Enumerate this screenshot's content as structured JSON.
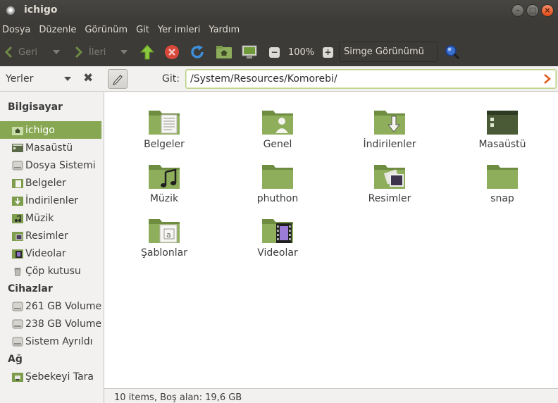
{
  "window": {
    "title": "ichigo"
  },
  "menu": [
    "Dosya",
    "Düzenle",
    "Görünüm",
    "Git",
    "Yer imleri",
    "Yardım"
  ],
  "toolbar": {
    "back_label": "Geri",
    "forward_label": "İleri",
    "zoom_level": "100%",
    "view_mode": "Simge Görünümü"
  },
  "location": {
    "places_label": "Yerler",
    "go_label": "Git:",
    "path": "/System/Resources/Komorebi/"
  },
  "sidebar": {
    "computer_heading": "Bilgisayar",
    "computer_items": [
      {
        "label": "ichigo",
        "icon": "home-folder-icon",
        "selected": true
      },
      {
        "label": "Masaüstü",
        "icon": "desktop-icon"
      },
      {
        "label": "Dosya Sistemi",
        "icon": "drive-icon"
      },
      {
        "label": "Belgeler",
        "icon": "documents-folder-icon"
      },
      {
        "label": "İndirilenler",
        "icon": "downloads-folder-icon"
      },
      {
        "label": "Müzik",
        "icon": "music-folder-icon"
      },
      {
        "label": "Resimler",
        "icon": "pictures-folder-icon"
      },
      {
        "label": "Videolar",
        "icon": "videos-folder-icon"
      },
      {
        "label": "Çöp kutusu",
        "icon": "trash-icon"
      }
    ],
    "devices_heading": "Cihazlar",
    "device_items": [
      {
        "label": "261 GB Volume",
        "icon": "drive-icon"
      },
      {
        "label": "238 GB Volume",
        "icon": "drive-icon"
      },
      {
        "label": "Sistem Ayrıldı",
        "icon": "drive-icon"
      }
    ],
    "network_heading": "Ağ",
    "network_items": [
      {
        "label": "Şebekeyi Tara",
        "icon": "network-icon"
      }
    ]
  },
  "files": [
    {
      "label": "Belgeler",
      "icon": "documents-folder-icon"
    },
    {
      "label": "Genel",
      "icon": "public-folder-icon"
    },
    {
      "label": "İndirilenler",
      "icon": "downloads-folder-icon"
    },
    {
      "label": "Masaüstü",
      "icon": "desktop-folder-icon"
    },
    {
      "label": "Müzik",
      "icon": "music-folder-icon"
    },
    {
      "label": "phuthon",
      "icon": "folder-icon"
    },
    {
      "label": "Resimler",
      "icon": "pictures-folder-icon"
    },
    {
      "label": "snap",
      "icon": "folder-icon"
    },
    {
      "label": "Şablonlar",
      "icon": "templates-folder-icon"
    },
    {
      "label": "Videolar",
      "icon": "videos-folder-icon"
    }
  ],
  "status": {
    "text": "10 items, Boş alan: 19,6 GB"
  },
  "colors": {
    "accent": "#87a752",
    "folder": "#8fae5c",
    "chrome": "#3c3b37"
  }
}
